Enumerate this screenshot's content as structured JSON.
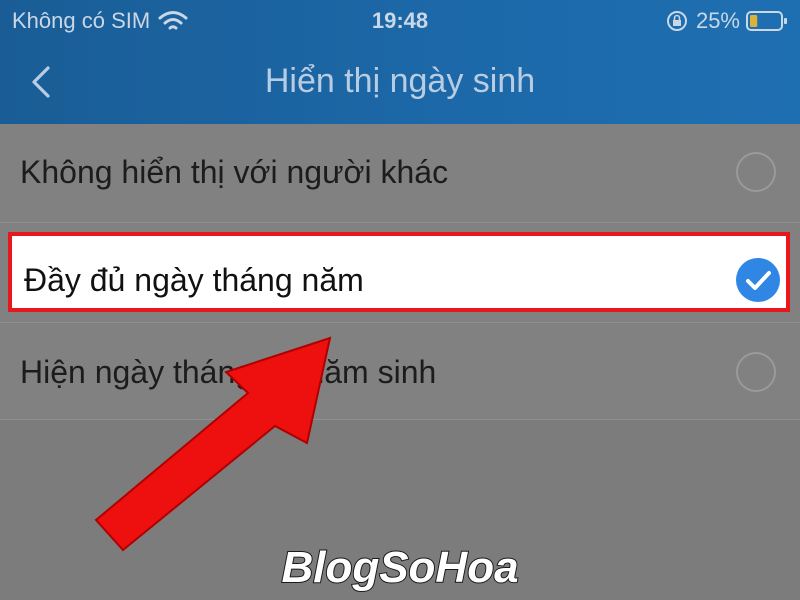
{
  "status_bar": {
    "carrier": "Không có SIM",
    "time": "19:48",
    "battery_percent": "25%",
    "battery_level": 0.25,
    "icons": [
      "wifi-icon",
      "rotation-lock-icon",
      "battery-icon"
    ]
  },
  "nav": {
    "back_icon": "chevron-left-icon",
    "title": "Hiển thị ngày sinh"
  },
  "options": [
    {
      "label": "Không hiển thị với người khác",
      "selected": false
    },
    {
      "label": "Đầy đủ ngày tháng năm",
      "selected": true
    },
    {
      "label": "Hiện ngày tháng ẩn năm sinh",
      "selected": false
    }
  ],
  "watermark": {
    "text": "BlogSoHoa"
  },
  "colors": {
    "header": "#1c68a8",
    "accent": "#2f86e4",
    "highlight_border": "#e8171b",
    "annotation_arrow": "#ee0f0f"
  }
}
